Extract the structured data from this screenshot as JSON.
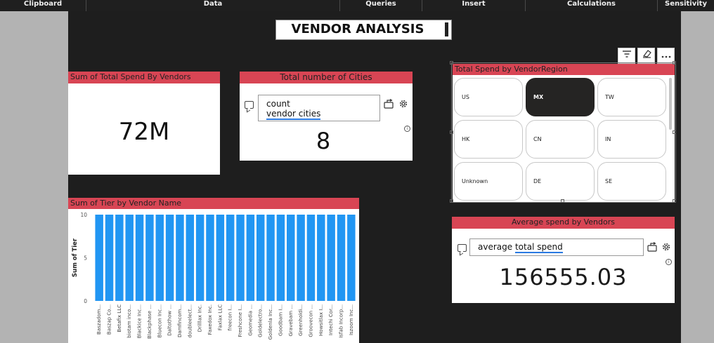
{
  "ribbon": {
    "groups": [
      {
        "label": "Clipboard"
      },
      {
        "label": "Data"
      },
      {
        "label": "Queries"
      },
      {
        "label": "Insert"
      },
      {
        "label": "Calculations"
      },
      {
        "label": "Sensitivity"
      }
    ]
  },
  "report": {
    "title": "VENDOR ANALYSIS",
    "toolbar": {
      "icons": [
        "filter-icon",
        "eraser-icon",
        "more-options-icon"
      ]
    }
  },
  "card_total_spend": {
    "header": "Sum of Total Spend By Vendors",
    "value": "72M"
  },
  "card_cities": {
    "header": "Total number of Cities",
    "query_line1": "count",
    "query_line2": "vendor cities",
    "value": "8"
  },
  "slicer_region": {
    "header": "Total Spend by VendorRegion",
    "tiles": [
      {
        "label": "US",
        "selected": false
      },
      {
        "label": "MX",
        "selected": true
      },
      {
        "label": "TW",
        "selected": false
      },
      {
        "label": "HK",
        "selected": false
      },
      {
        "label": "CN",
        "selected": false
      },
      {
        "label": "IN",
        "selected": false
      },
      {
        "label": "Unknown",
        "selected": false
      },
      {
        "label": "DE",
        "selected": false
      },
      {
        "label": "SE",
        "selected": false
      }
    ],
    "selected_color": "#252423"
  },
  "card_avg_spend": {
    "header": "Average spend by Vendors",
    "query_word1": "average",
    "query_word2": "total spend",
    "value": "156555.03"
  },
  "colors": {
    "header_bar": "#d84554",
    "bar_fill": "#2196f3",
    "canvas": "#1e1e1e"
  },
  "chart_data": {
    "type": "bar",
    "title": "Sum of Tier by Vendor Name",
    "xlabel": "",
    "ylabel": "Sum of Tier",
    "ylim": [
      0,
      10
    ],
    "yticks": [
      0,
      5,
      10
    ],
    "grid": false,
    "categories": [
      "Baszadom...",
      "Baszap Co...",
      "Betafix LLC",
      "biotam inco...",
      "Blackice Inc...",
      "Blackphase ...",
      "Bluecon Inc...",
      "Daltothow ...",
      "Damfincom...",
      "doubleelect...",
      "Drilllax Inc.",
      "Faxedox Inc.",
      "Faxlax LLC",
      "freecon I...",
      "Freshcone I...",
      "Geomedia ...",
      "Goldelectro...",
      "Goldenla Inc...",
      "Goodbam I...",
      "Gravebam ...",
      "Greenholdi...",
      "Groovecon ...",
      "Howsitlax I...",
      "Intechi Cor...",
      "Isfab Incorp...",
      "Iszoom Inc..."
    ],
    "values": [
      10,
      10,
      10,
      10,
      10,
      10,
      10,
      10,
      10,
      10,
      10,
      10,
      10,
      10,
      10,
      10,
      10,
      10,
      10,
      10,
      10,
      10,
      10,
      10,
      10,
      10
    ]
  }
}
